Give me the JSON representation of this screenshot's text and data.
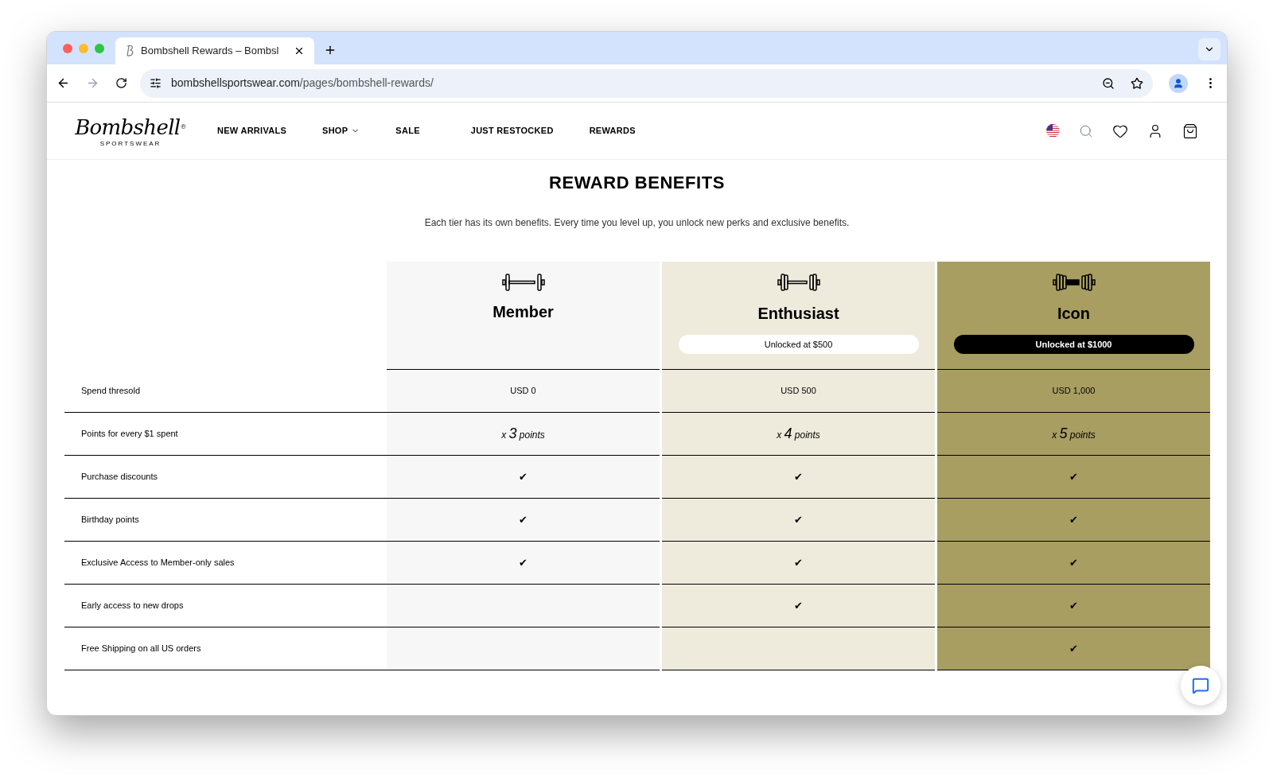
{
  "browser": {
    "tab_title": "Bombshell Rewards – Bombsl",
    "url_domain": "bombshellsportswear.com",
    "url_path": "/pages/bombshell-rewards/"
  },
  "site": {
    "logo": "Bombshell",
    "logo_sub": "SPORTSWEAR",
    "logo_mark": "®",
    "nav": [
      {
        "label": "NEW ARRIVALS",
        "dropdown": false
      },
      {
        "label": "SHOP",
        "dropdown": true
      },
      {
        "label": "SALE",
        "dropdown": false
      },
      {
        "label": "JUST RESTOCKED",
        "dropdown": false
      },
      {
        "label": "REWARDS",
        "dropdown": false
      }
    ]
  },
  "page": {
    "title": "REWARD BENEFITS",
    "subtitle": "Each tier has its own benefits. Every time you level up, you unlock new perks and exclusive benefits."
  },
  "tiers": [
    {
      "name": "Member",
      "color": "#f7f7f7"
    },
    {
      "name": "Enthusiast",
      "color": "#eeebdd",
      "badge": {
        "kind": "light",
        "text": "Unlocked at $500"
      }
    },
    {
      "name": "Icon",
      "color": "#a89e61",
      "badge": {
        "kind": "dark",
        "text": "Unlocked at $1000"
      }
    }
  ],
  "rows": [
    {
      "label": "Spend thresold",
      "cells": [
        {
          "kind": "text",
          "text": "USD 0"
        },
        {
          "kind": "text",
          "text": "USD 500"
        },
        {
          "kind": "text",
          "text": "USD 1,000"
        }
      ]
    },
    {
      "label": "Points for every $1 spent",
      "cells": [
        {
          "kind": "points",
          "prefix": "x",
          "number": "3",
          "suffix": "points"
        },
        {
          "kind": "points",
          "prefix": "x",
          "number": "4",
          "suffix": "points"
        },
        {
          "kind": "points",
          "prefix": "x",
          "number": "5",
          "suffix": "points"
        }
      ]
    },
    {
      "label": "Purchase discounts",
      "cells": [
        {
          "kind": "check",
          "text": "✔"
        },
        {
          "kind": "check",
          "text": "✔"
        },
        {
          "kind": "check",
          "text": "✔"
        }
      ]
    },
    {
      "label": "Birthday points",
      "cells": [
        {
          "kind": "check",
          "text": "✔"
        },
        {
          "kind": "check",
          "text": "✔"
        },
        {
          "kind": "check",
          "text": "✔"
        }
      ]
    },
    {
      "label": "Exclusive Access to Member-only sales",
      "cells": [
        {
          "kind": "check",
          "text": "✔"
        },
        {
          "kind": "check",
          "text": "✔"
        },
        {
          "kind": "check",
          "text": "✔"
        }
      ]
    },
    {
      "label": "Early access to new drops",
      "cells": [
        {
          "kind": "empty"
        },
        {
          "kind": "check",
          "text": "✔"
        },
        {
          "kind": "check",
          "text": "✔"
        }
      ]
    },
    {
      "label": "Free Shipping on all US orders",
      "cells": [
        {
          "kind": "empty"
        },
        {
          "kind": "empty"
        },
        {
          "kind": "check",
          "text": "✔"
        }
      ]
    }
  ]
}
